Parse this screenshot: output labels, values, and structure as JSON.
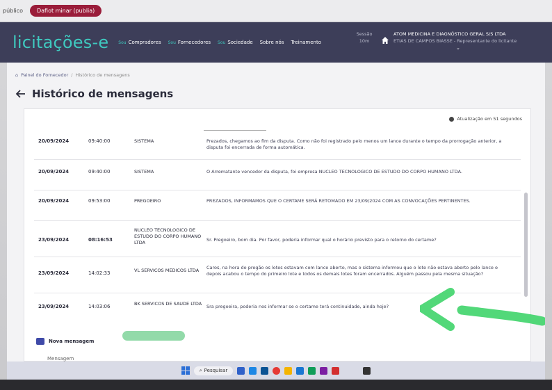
{
  "browser": {
    "prefix": "público",
    "open_button": "Dafiot minar (publia)"
  },
  "header": {
    "logo": "licitações-e",
    "nav": [
      {
        "pre": "Sou",
        "label": "Compradores"
      },
      {
        "pre": "Sou",
        "label": "Fornecedores"
      },
      {
        "pre": "Sou",
        "label": "Sociedade"
      },
      {
        "pre": "",
        "label": "Sobre nós"
      },
      {
        "pre": "",
        "label": "Treinamento"
      }
    ],
    "session_label": "Sessão",
    "session_value": "10m",
    "org_name": "ATOM MEDICINA E DIAGNÓSTICO GERAL S/S LTDA",
    "org_sub": "ETIAS DE CAMPOS BIASSE - Representante do licitante"
  },
  "breadcrumb": {
    "home": "Painel do Fornecedor",
    "separator": "/",
    "current": "Histórico de mensagens"
  },
  "page": {
    "title": "Histórico de mensagens",
    "refresh_text": "Atualização em 51 segundos"
  },
  "messages": [
    {
      "date": "20/09/2024",
      "time": "09:40:00",
      "sender": "SISTEMA",
      "text": "Prezados, chegamos ao fim da disputa. Como não foi registrado pelo menos um lance durante o tempo da prorrogação anterior, a disputa foi encerrada de forma automática."
    },
    {
      "date": "20/09/2024",
      "time": "09:40:00",
      "sender": "SISTEMA",
      "text": "O Arrematante vencedor da disputa, foi empresa NUCLEO TECNOLOGICO DE ESTUDO DO CORPO HUMANO LTDA."
    },
    {
      "date": "20/09/2024",
      "time": "09:53:00",
      "sender": "PREGOEIRO",
      "text": "PREZADOS, INFORMAMOS QUE O CERTAME SERÁ RETOMADO EM 23/09/2024 COM AS CONVOCAÇÕES PERTINENTES."
    },
    {
      "date": "23/09/2024",
      "time": "08:16:53",
      "sender": "NUCLEO TECNOLOGICO DE ESTUDO DO CORPO HUMANO LTDA",
      "text": "Sr. Pregoeiro, bom dia. Por favor, poderia informar qual o horário previsto para o retorno do certame?"
    },
    {
      "date": "23/09/2024",
      "time": "14:02:33",
      "sender": "VL SERVICOS MEDICOS LTDA",
      "text": "Caros, na hora do pregão os lotes estavam com lance aberto, mas o sistema informou que o lote não estava aberto pelo lance e depois acabou o tempo do primeiro lote e todos os demais lotes foram encerrados. Alguém passou pela mesma situação?"
    },
    {
      "date": "23/09/2024",
      "time": "14:03:06",
      "sender": "BK SERVICOS DE SAUDE LTDA",
      "text": "Sra pregoeira, poderia nos informar se o certame terá continuidade, ainda hoje?"
    }
  ],
  "composer": {
    "new_message": "Nova mensagem",
    "message_label": "Mensagem"
  },
  "taskbar": {
    "search_label": "Pesquisar"
  },
  "colors": {
    "header_bg": "#3d3e59",
    "logo": "#3fc9bf",
    "annotation_green": "#3fd46a"
  },
  "icons": [
    "home-icon",
    "back-arrow-icon",
    "refresh-icon",
    "chat-icon",
    "windows-icon",
    "search-icon"
  ]
}
